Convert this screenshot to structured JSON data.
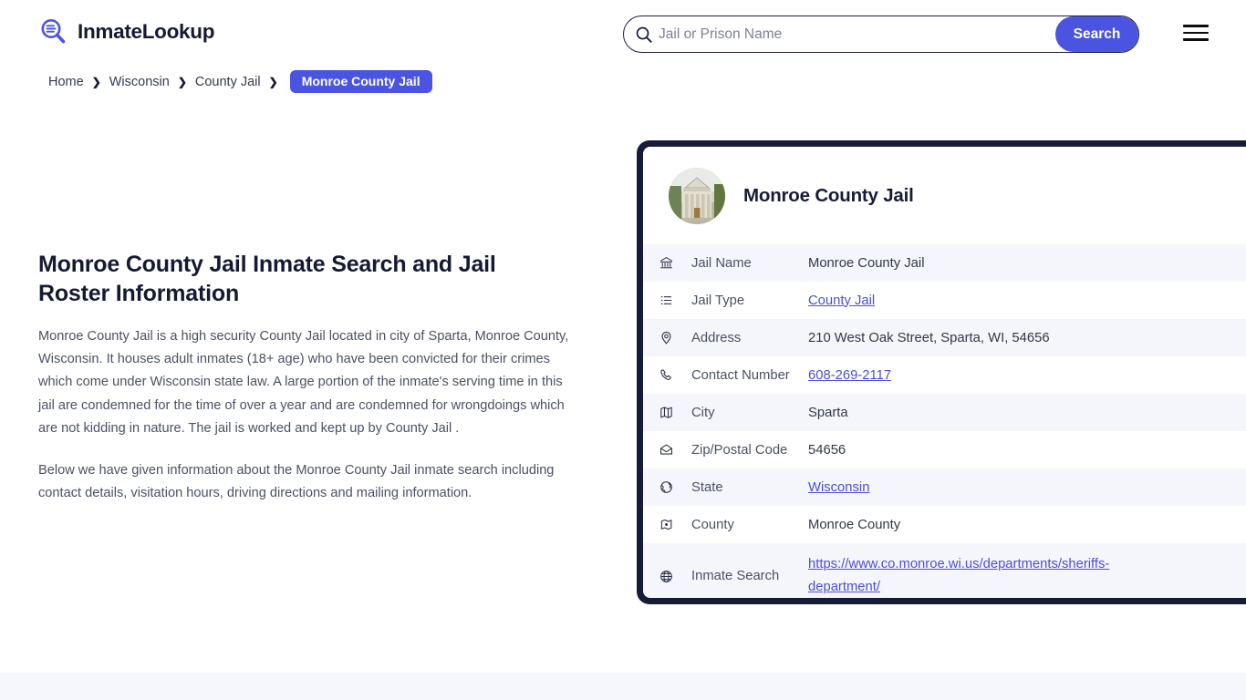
{
  "header": {
    "brand_name": "InmateLookup",
    "brand_icon": "search-logo-icon",
    "search": {
      "placeholder": "Jail or Prison Name",
      "value": "",
      "icon": "search-icon",
      "button_label": "Search"
    },
    "menu_icon": "hamburger-menu-icon"
  },
  "breadcrumb": {
    "items": [
      {
        "label": "Home",
        "current": false
      },
      {
        "label": "Wisconsin",
        "current": false
      },
      {
        "label": "County Jail",
        "current": false
      },
      {
        "label": "Monroe County Jail",
        "current": true
      }
    ],
    "separator": "❯"
  },
  "main": {
    "title": "Monroe County Jail Inmate Search and Jail Roster Information",
    "paragraph1": "Monroe County Jail is a high security County Jail located in city of Sparta, Monroe County, Wisconsin. It houses adult inmates (18+ age) who have been convicted for their crimes which come under Wisconsin state law. A large portion of the inmate's serving time in this jail are condemned for the time of over a year and are condemned for wrongdoings which are not kidding in nature. The jail is worked and kept up by County Jail .",
    "paragraph2": "Below we have given information about the Monroe County Jail inmate search including contact details, visitation hours, driving directions and mailing information."
  },
  "card": {
    "avatar_icon": "courthouse-photo",
    "title": "Monroe County Jail",
    "rows": [
      {
        "icon": "bank-icon",
        "label": "Jail Name",
        "value": "Monroe County Jail",
        "is_link": false
      },
      {
        "icon": "list-icon",
        "label": "Jail Type",
        "value": "County Jail",
        "is_link": true
      },
      {
        "icon": "location-pin-icon",
        "label": "Address",
        "value": "210 West Oak Street, Sparta, WI, 54656",
        "is_link": false
      },
      {
        "icon": "phone-icon",
        "label": "Contact Number",
        "value": "608-269-2117",
        "is_link": true
      },
      {
        "icon": "map-icon",
        "label": "City",
        "value": "Sparta",
        "is_link": false
      },
      {
        "icon": "envelope-icon",
        "label": "Zip/Postal Code",
        "value": "54656",
        "is_link": false
      },
      {
        "icon": "globe-icon",
        "label": "State",
        "value": "Wisconsin",
        "is_link": true
      },
      {
        "icon": "county-map-icon",
        "label": "County",
        "value": "Monroe County",
        "is_link": false
      },
      {
        "icon": "web-globe-icon",
        "label": "Inmate Search",
        "value": "https://www.co.monroe.wi.us/departments/sheriffs-department/",
        "is_link": true
      }
    ]
  },
  "colors": {
    "accent_blue": "#4a54e1",
    "card_border": "#161c38",
    "link": "#4b4fd6",
    "row_alt": "#f5f5fc",
    "bottom_band": "#f6f6fd"
  }
}
